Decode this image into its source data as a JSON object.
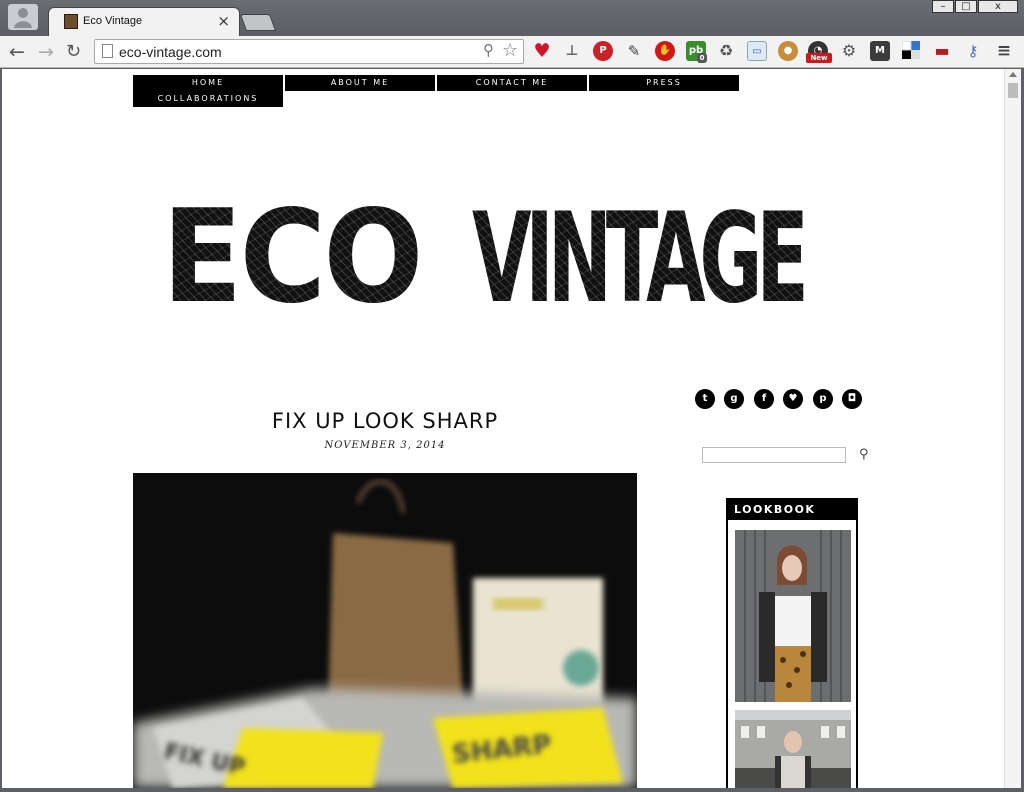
{
  "browser": {
    "tab_title": "Eco Vintage",
    "tab_close": "×",
    "url": "eco-vintage.com",
    "window_controls": [
      "–",
      "□",
      "x"
    ],
    "extension_badges": {
      "pb_count": "0",
      "new_label": "New"
    }
  },
  "site": {
    "menu": [
      "HOME",
      "ABOUT ME",
      "CONTACT ME",
      "PRESS",
      "COLLABORATIONS"
    ],
    "logo_text_left": "ECO",
    "logo_text_right": "VINTAGE",
    "social_icons": [
      "twitter-icon",
      "google-plus-icon",
      "facebook-icon",
      "heart-icon",
      "pinterest-icon",
      "instagram-icon"
    ],
    "social_glyphs": [
      "t",
      "g",
      "f",
      "♥",
      "p",
      "◘"
    ]
  },
  "post": {
    "title": "FIX UP LOOK SHARP",
    "date": "NOVEMBER 3, 2014"
  },
  "sidebar": {
    "lookbook_title": "LOOKBOOK"
  },
  "colors": {
    "page_bg": "#ffffff",
    "accent": "#000000",
    "tshirt_yellow": "#f2e21a"
  }
}
